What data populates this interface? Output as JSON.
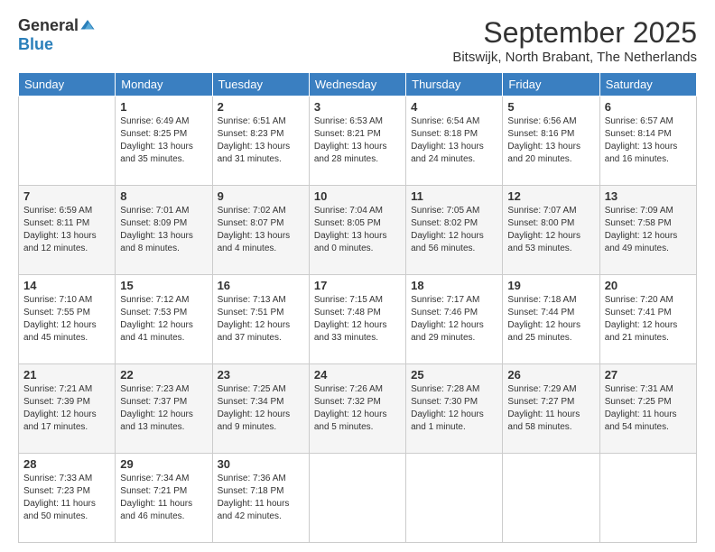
{
  "logo": {
    "general": "General",
    "blue": "Blue"
  },
  "title": "September 2025",
  "location": "Bitswijk, North Brabant, The Netherlands",
  "days_of_week": [
    "Sunday",
    "Monday",
    "Tuesday",
    "Wednesday",
    "Thursday",
    "Friday",
    "Saturday"
  ],
  "weeks": [
    [
      {
        "day": "",
        "info": ""
      },
      {
        "day": "1",
        "info": "Sunrise: 6:49 AM\nSunset: 8:25 PM\nDaylight: 13 hours\nand 35 minutes."
      },
      {
        "day": "2",
        "info": "Sunrise: 6:51 AM\nSunset: 8:23 PM\nDaylight: 13 hours\nand 31 minutes."
      },
      {
        "day": "3",
        "info": "Sunrise: 6:53 AM\nSunset: 8:21 PM\nDaylight: 13 hours\nand 28 minutes."
      },
      {
        "day": "4",
        "info": "Sunrise: 6:54 AM\nSunset: 8:18 PM\nDaylight: 13 hours\nand 24 minutes."
      },
      {
        "day": "5",
        "info": "Sunrise: 6:56 AM\nSunset: 8:16 PM\nDaylight: 13 hours\nand 20 minutes."
      },
      {
        "day": "6",
        "info": "Sunrise: 6:57 AM\nSunset: 8:14 PM\nDaylight: 13 hours\nand 16 minutes."
      }
    ],
    [
      {
        "day": "7",
        "info": "Sunrise: 6:59 AM\nSunset: 8:11 PM\nDaylight: 13 hours\nand 12 minutes."
      },
      {
        "day": "8",
        "info": "Sunrise: 7:01 AM\nSunset: 8:09 PM\nDaylight: 13 hours\nand 8 minutes."
      },
      {
        "day": "9",
        "info": "Sunrise: 7:02 AM\nSunset: 8:07 PM\nDaylight: 13 hours\nand 4 minutes."
      },
      {
        "day": "10",
        "info": "Sunrise: 7:04 AM\nSunset: 8:05 PM\nDaylight: 13 hours\nand 0 minutes."
      },
      {
        "day": "11",
        "info": "Sunrise: 7:05 AM\nSunset: 8:02 PM\nDaylight: 12 hours\nand 56 minutes."
      },
      {
        "day": "12",
        "info": "Sunrise: 7:07 AM\nSunset: 8:00 PM\nDaylight: 12 hours\nand 53 minutes."
      },
      {
        "day": "13",
        "info": "Sunrise: 7:09 AM\nSunset: 7:58 PM\nDaylight: 12 hours\nand 49 minutes."
      }
    ],
    [
      {
        "day": "14",
        "info": "Sunrise: 7:10 AM\nSunset: 7:55 PM\nDaylight: 12 hours\nand 45 minutes."
      },
      {
        "day": "15",
        "info": "Sunrise: 7:12 AM\nSunset: 7:53 PM\nDaylight: 12 hours\nand 41 minutes."
      },
      {
        "day": "16",
        "info": "Sunrise: 7:13 AM\nSunset: 7:51 PM\nDaylight: 12 hours\nand 37 minutes."
      },
      {
        "day": "17",
        "info": "Sunrise: 7:15 AM\nSunset: 7:48 PM\nDaylight: 12 hours\nand 33 minutes."
      },
      {
        "day": "18",
        "info": "Sunrise: 7:17 AM\nSunset: 7:46 PM\nDaylight: 12 hours\nand 29 minutes."
      },
      {
        "day": "19",
        "info": "Sunrise: 7:18 AM\nSunset: 7:44 PM\nDaylight: 12 hours\nand 25 minutes."
      },
      {
        "day": "20",
        "info": "Sunrise: 7:20 AM\nSunset: 7:41 PM\nDaylight: 12 hours\nand 21 minutes."
      }
    ],
    [
      {
        "day": "21",
        "info": "Sunrise: 7:21 AM\nSunset: 7:39 PM\nDaylight: 12 hours\nand 17 minutes."
      },
      {
        "day": "22",
        "info": "Sunrise: 7:23 AM\nSunset: 7:37 PM\nDaylight: 12 hours\nand 13 minutes."
      },
      {
        "day": "23",
        "info": "Sunrise: 7:25 AM\nSunset: 7:34 PM\nDaylight: 12 hours\nand 9 minutes."
      },
      {
        "day": "24",
        "info": "Sunrise: 7:26 AM\nSunset: 7:32 PM\nDaylight: 12 hours\nand 5 minutes."
      },
      {
        "day": "25",
        "info": "Sunrise: 7:28 AM\nSunset: 7:30 PM\nDaylight: 12 hours\nand 1 minute."
      },
      {
        "day": "26",
        "info": "Sunrise: 7:29 AM\nSunset: 7:27 PM\nDaylight: 11 hours\nand 58 minutes."
      },
      {
        "day": "27",
        "info": "Sunrise: 7:31 AM\nSunset: 7:25 PM\nDaylight: 11 hours\nand 54 minutes."
      }
    ],
    [
      {
        "day": "28",
        "info": "Sunrise: 7:33 AM\nSunset: 7:23 PM\nDaylight: 11 hours\nand 50 minutes."
      },
      {
        "day": "29",
        "info": "Sunrise: 7:34 AM\nSunset: 7:21 PM\nDaylight: 11 hours\nand 46 minutes."
      },
      {
        "day": "30",
        "info": "Sunrise: 7:36 AM\nSunset: 7:18 PM\nDaylight: 11 hours\nand 42 minutes."
      },
      {
        "day": "",
        "info": ""
      },
      {
        "day": "",
        "info": ""
      },
      {
        "day": "",
        "info": ""
      },
      {
        "day": "",
        "info": ""
      }
    ]
  ]
}
